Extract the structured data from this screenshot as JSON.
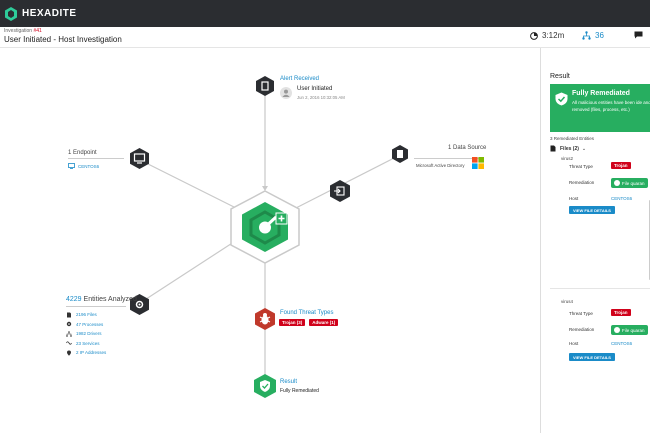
{
  "app": {
    "brand": "HEXADITE"
  },
  "header": {
    "inv_prefix": "Investigation",
    "inv_number": "#41",
    "title": "User Initiated - Host Investigation",
    "time": "3:12m",
    "entities_count": "36"
  },
  "graph": {
    "alert": {
      "title": "Alert Received",
      "subtitle": "User Initiated",
      "timestamp": "Jun 2, 2016 10:32:05 AM"
    },
    "endpoint": {
      "title": "1 Endpoint",
      "host": "CENTOS6"
    },
    "datasource": {
      "title": "1 Data Source",
      "name": "Microsoft Active Directory"
    },
    "entities": {
      "count": "4229",
      "title_suffix": "Entities Analyzed",
      "items": [
        {
          "value": "2196",
          "label": "Files"
        },
        {
          "value": "47",
          "label": "Processes"
        },
        {
          "value": "1982",
          "label": "Drivers"
        },
        {
          "value": "23",
          "label": "Services"
        },
        {
          "value": "2",
          "label": "IP Addresses"
        }
      ]
    },
    "threats": {
      "title": "Found Threat Types",
      "tags": [
        "Trojan (3)",
        "Adware (1)"
      ]
    },
    "result": {
      "title": "Result",
      "value": "Fully Remediated"
    }
  },
  "panel": {
    "title": "Result",
    "status_title": "Fully Remediated",
    "status_desc": "All malicious entities have been ide and removed (files, process, etc.)",
    "remediated_header": "3 Remediated Entities",
    "files_label": "Files (2)",
    "entities": [
      {
        "name": "virus2",
        "threat_type_label": "Threat Type",
        "threat_type": "Trojan",
        "remediation_label": "Remediation",
        "remediation": "File quaran",
        "host_label": "Host",
        "host": "CENTOS6",
        "button": "VIEW FILE DETAILS"
      },
      {
        "name": "virus4",
        "threat_type_label": "Threat Type",
        "threat_type": "Trojan",
        "remediation_label": "Remediation",
        "remediation": "File quaran",
        "host_label": "Host",
        "host": "CENTOS6",
        "button": "VIEW FILE DETAILS"
      }
    ]
  },
  "colors": {
    "topbar": "#2b2d31",
    "accent": "#1a8bc8",
    "success": "#27ae60",
    "danger": "#d0021b",
    "node_dark": "#2b2d31"
  },
  "icons": [
    "hexadite-logo-icon",
    "clock-icon",
    "entities-icon",
    "chat-icon",
    "alert-icon",
    "monitor-icon",
    "server-icon",
    "windows-icon",
    "connector-icon",
    "settings-icon",
    "bug-icon",
    "shield-check-icon",
    "file-icon"
  ]
}
